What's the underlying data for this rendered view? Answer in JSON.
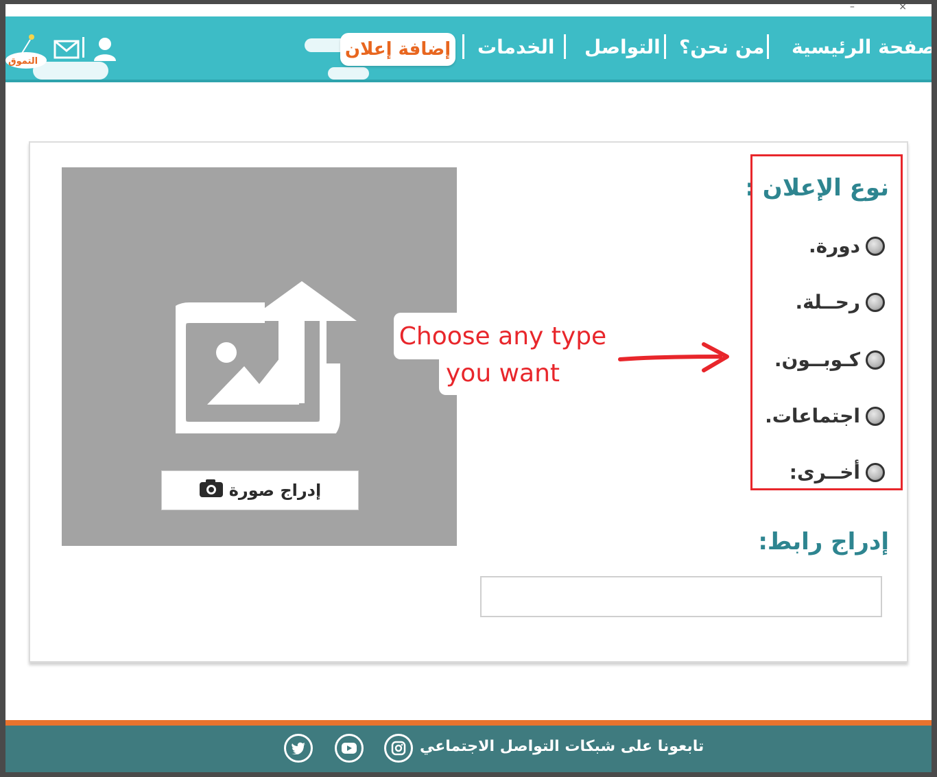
{
  "nav": {
    "items": [
      "الصفحة الرئيسية",
      "من نحن؟",
      "التواصل",
      "الخدمات"
    ],
    "add_ad": "إضافة إعلان",
    "logo_text": "التموق"
  },
  "form": {
    "type_title": "نوع الإعلان :",
    "options": [
      "دورة.",
      "رحــلة.",
      "كـوبــون.",
      "اجتماعات.",
      "أخــرى:"
    ],
    "link_title": "إدراج رابط:",
    "link_value": "",
    "upload_label": "إدراج صورة"
  },
  "annotation": {
    "line1": "Choose any type",
    "line2": "you want",
    "color": "#e8262b"
  },
  "footer": {
    "text": "تابعونا على شبكات التواصل الاجتماعي",
    "social": [
      "instagram-icon",
      "youtube-icon",
      "twitter-icon"
    ]
  },
  "colors": {
    "header": "#3dbcc6",
    "accent": "#e8661f",
    "footer": "#3f7b7f",
    "title": "#2e8590"
  }
}
